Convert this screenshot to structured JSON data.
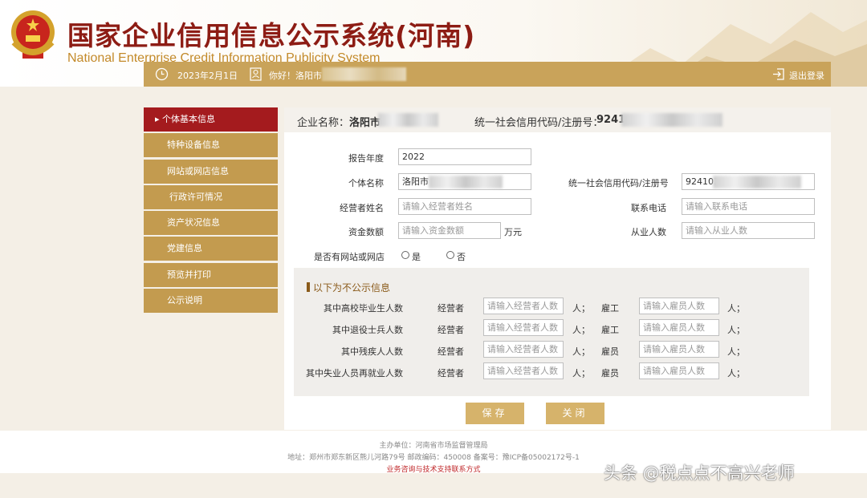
{
  "header": {
    "title": "国家企业信用信息公示系统(河南)",
    "subtitle": "National Enterprise Credit Information Publicity System"
  },
  "topbar": {
    "date": "2023年2月1日",
    "greeting": "你好！洛阳市",
    "logout": "退出登录"
  },
  "sidebar": {
    "items": [
      {
        "label": "▸ 个体基本信息"
      },
      {
        "label": "特种设备信息"
      },
      {
        "label": "网站或网店信息"
      },
      {
        "label": "行政许可情况"
      },
      {
        "label": "资产状况信息"
      },
      {
        "label": "党建信息"
      },
      {
        "label": "预览并打印"
      },
      {
        "label": "公示说明"
      }
    ]
  },
  "info_bar": {
    "company_label": "企业名称：",
    "company_value": "洛阳市",
    "code_label": "统一社会信用代码/注册号：",
    "code_value": "9241"
  },
  "form": {
    "report_year_label": "报告年度",
    "report_year_value": "2022",
    "name_label": "个体名称",
    "name_value": "洛阳市",
    "code_label": "统一社会信用代码/注册号",
    "code_value": "924103",
    "operator_label": "经营者姓名",
    "operator_placeholder": "请输入经营者姓名",
    "phone_label": "联系电话",
    "phone_placeholder": "请输入联系电话",
    "capital_label": "资金数额",
    "capital_placeholder": "请输入资金数额",
    "capital_unit": "万元",
    "staff_label": "从业人数",
    "staff_placeholder": "请输入从业人数",
    "has_website_label": "是否有网站或网店",
    "yes_label": "是",
    "no_label": "否"
  },
  "nonpublic": {
    "title": "以下为不公示信息",
    "rows": [
      {
        "label": "其中高校毕业生人数",
        "op_label": "经营者",
        "op_placeholder": "请输入经营者人数",
        "unit1": "人；",
        "emp_label": "雇工",
        "emp_placeholder": "请输入雇员人数",
        "unit2": "人；"
      },
      {
        "label": "其中退役士兵人数",
        "op_label": "经营者",
        "op_placeholder": "请输入经营者人数",
        "unit1": "人；",
        "emp_label": "雇工",
        "emp_placeholder": "请输入雇员人数",
        "unit2": "人；"
      },
      {
        "label": "其中残疾人人数",
        "op_label": "经营者",
        "op_placeholder": "请输入经营者人数",
        "unit1": "人；",
        "emp_label": "雇员",
        "emp_placeholder": "请输入雇员人数",
        "unit2": "人；"
      },
      {
        "label": "其中失业人员再就业人数",
        "op_label": "经营者",
        "op_placeholder": "请输入经营者人数",
        "unit1": "人；",
        "emp_label": "雇员",
        "emp_placeholder": "请输入雇员人数",
        "unit2": "人；"
      }
    ]
  },
  "buttons": {
    "save": "保存",
    "close": "关闭"
  },
  "footer": {
    "sponsor": "主办单位：河南省市场监督管理局",
    "address": "地址：郑州市郑东新区熊儿河路79号 邮政编码：450008 备案号：豫ICP备05002172号-1",
    "support": "业务咨询与技术支持联系方式"
  },
  "watermark": "头条 @税点点不高兴老师",
  "colors": {
    "brand_red": "#8d1c14",
    "gold": "#c9a35a",
    "sidebar_active": "#a41b1e",
    "sidebar_item": "#c39b4f"
  }
}
